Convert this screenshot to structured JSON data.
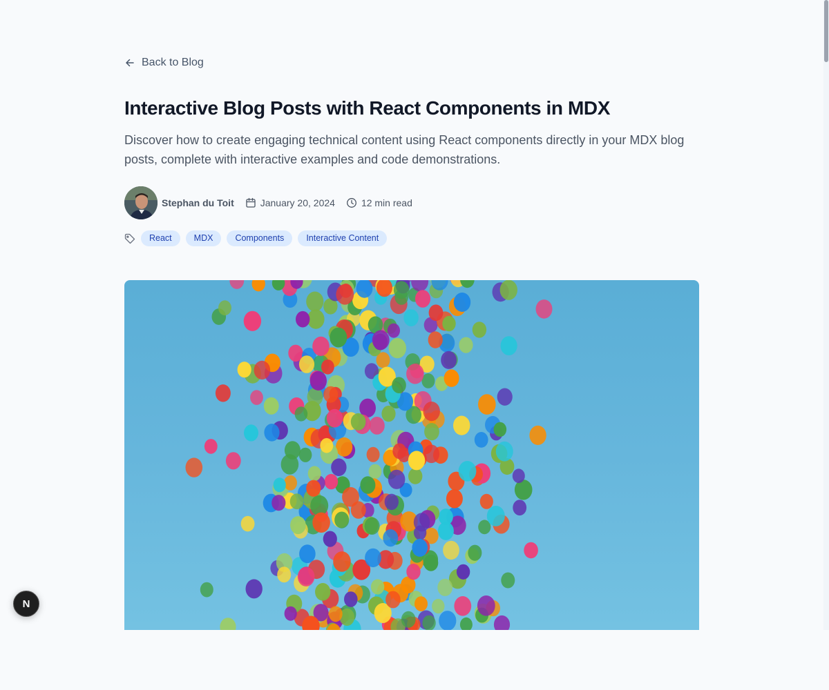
{
  "nav": {
    "back_label": "Back to Blog"
  },
  "post": {
    "title": "Interactive Blog Posts with React Components in MDX",
    "description": "Discover how to create engaging technical content using React components directly in your MDX blog posts, complete with interactive examples and code demonstrations.",
    "author": "Stephan du Toit",
    "date": "January 20, 2024",
    "read_time": "12 min read",
    "tags": [
      "React",
      "MDX",
      "Components",
      "Interactive Content"
    ]
  },
  "icons": {
    "back": "arrow-left-icon",
    "date": "calendar-icon",
    "read_time": "clock-icon",
    "tags": "tag-icon",
    "dev_indicator": "nextjs-logo-icon"
  },
  "dev_indicator": {
    "label": "N"
  },
  "colors": {
    "tag_bg": "#dbeafe",
    "tag_text": "#1e40af",
    "page_bg": "#f8fafc",
    "sky": "#5aaed6"
  }
}
